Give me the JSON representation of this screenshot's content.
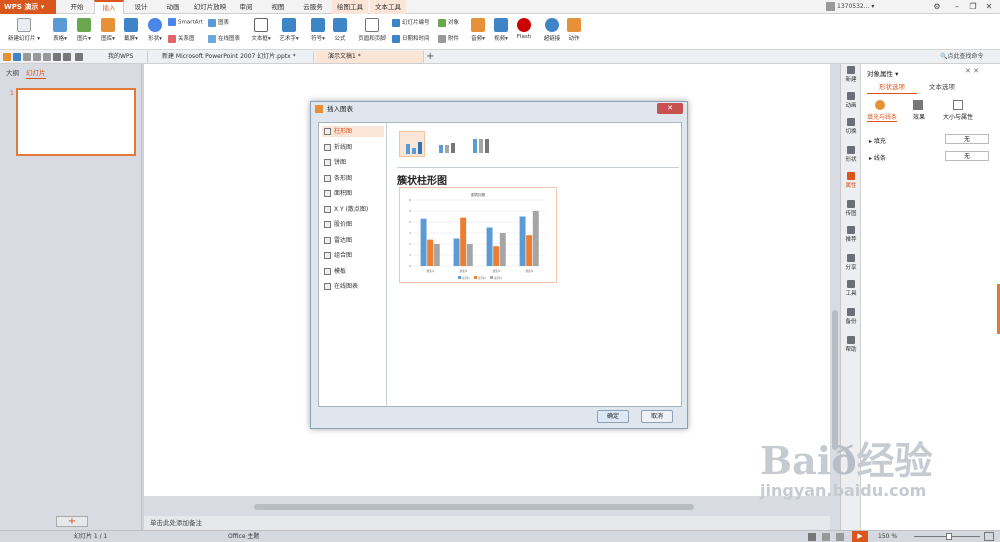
{
  "app": {
    "name": "WPS 演示"
  },
  "ribbon_tabs": [
    {
      "label": "开始",
      "active": false,
      "ctx": false
    },
    {
      "label": "插入",
      "active": true,
      "ctx": false
    },
    {
      "label": "设计",
      "active": false,
      "ctx": false
    },
    {
      "label": "动画",
      "active": false,
      "ctx": false
    },
    {
      "label": "幻灯片放映",
      "active": false,
      "ctx": false
    },
    {
      "label": "审阅",
      "active": false,
      "ctx": false
    },
    {
      "label": "视图",
      "active": false,
      "ctx": false
    },
    {
      "label": "云服务",
      "active": false,
      "ctx": false
    },
    {
      "label": "绘图工具",
      "active": false,
      "ctx": true
    },
    {
      "label": "文本工具",
      "active": false,
      "ctx": true
    }
  ],
  "account": {
    "name": "1370532..."
  },
  "ribbon": {
    "new_slide": "新建幻灯片",
    "table": "表格",
    "picture": "图片",
    "gallery": "图库",
    "screenshot": "截屏",
    "shape": "形状",
    "smartart": "SmartArt",
    "relation": "关系图",
    "chart": "图表",
    "online_chart": "在线图表",
    "textbox": "文本框",
    "wordart": "艺术字",
    "symbol": "符号",
    "formula": "公式",
    "header_footer": "页眉和页脚",
    "slide_number": "幻灯片编号",
    "object": "对象",
    "datetime": "日期和时间",
    "attachment": "附件",
    "audio": "音频",
    "video": "视频",
    "flash": "Flash",
    "hyperlink": "超链接",
    "action": "动作"
  },
  "doc_tabs": [
    {
      "label": "我的WPS",
      "active": false
    },
    {
      "label": "新建 Microsoft PowerPoint 2007 幻灯片.pptx *",
      "active": false
    },
    {
      "label": "演示文稿1 *",
      "active": true
    }
  ],
  "search": {
    "label": "点此查找命令"
  },
  "left_panel": {
    "tab_outline": "大纲",
    "tab_slides": "幻灯片",
    "slide_index": "1"
  },
  "notes": {
    "text": "单击此处添加备注"
  },
  "right_sidebar": [
    "新建",
    "动画",
    "切换",
    "形状",
    "属性",
    "传图",
    "推荐",
    "分享",
    "工具",
    "备份",
    "帮助"
  ],
  "properties": {
    "title": "对象属性",
    "tab_shape": "形状选项",
    "tab_text": "文本选项",
    "sub_fill": "填充与线条",
    "sub_effect": "效果",
    "sub_size": "大小与属性",
    "fill_label": "填充",
    "fill_value": "无",
    "line_label": "线条",
    "line_value": "无"
  },
  "dialog": {
    "title": "插入图表",
    "chart_types": [
      "柱形图",
      "折线图",
      "饼图",
      "条形图",
      "面积图",
      "X Y (散点图)",
      "股价图",
      "雷达图",
      "组合图",
      "模板",
      "在线图表"
    ],
    "selected_type": "簇状柱形图",
    "ok": "确定",
    "cancel": "取消"
  },
  "status": {
    "slide": "幻灯片 1 / 1",
    "theme": "Office 主题",
    "zoom": "150 %"
  },
  "colors": {
    "accent": "#d9561d",
    "blue": "#5b9bd5",
    "orange": "#ed7d31",
    "gray": "#a5a5a5"
  },
  "chart_data": {
    "type": "bar",
    "title": "图表标题",
    "categories": [
      "类别1",
      "类别2",
      "类别3",
      "类别4"
    ],
    "series": [
      {
        "name": "系列1",
        "values": [
          4.3,
          2.5,
          3.5,
          4.5
        ]
      },
      {
        "name": "系列2",
        "values": [
          2.4,
          4.4,
          1.8,
          2.8
        ]
      },
      {
        "name": "系列3",
        "values": [
          2.0,
          2.0,
          3.0,
          5.0
        ]
      }
    ],
    "ylim": [
      0,
      6
    ],
    "grid": true,
    "legend": "bottom"
  }
}
